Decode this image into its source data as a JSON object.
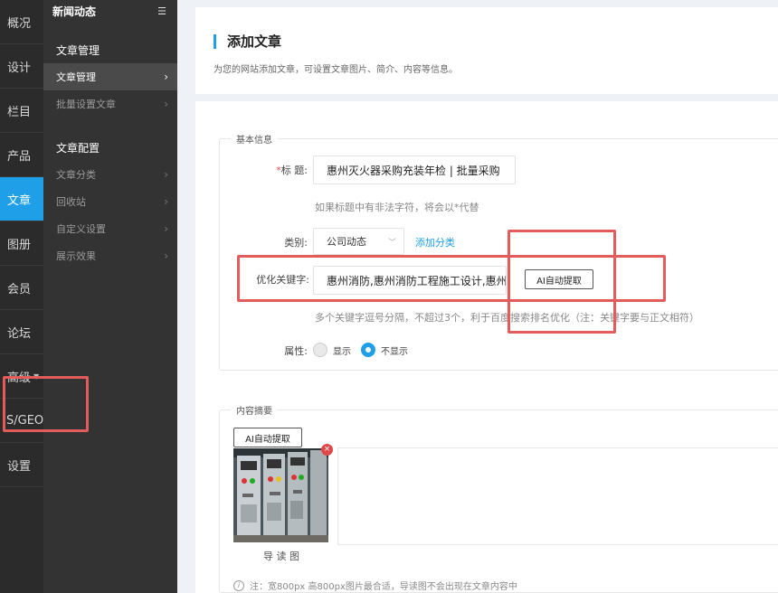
{
  "rail": {
    "items": [
      {
        "label": "概况"
      },
      {
        "label": "设计"
      },
      {
        "label": "栏目"
      },
      {
        "label": "产品"
      },
      {
        "label": "文章"
      },
      {
        "label": "图册"
      },
      {
        "label": "会员"
      },
      {
        "label": "论坛"
      },
      {
        "label": "高级"
      },
      {
        "label": "S/GEO"
      },
      {
        "label": "设置"
      }
    ]
  },
  "submenu": {
    "header": "新闻动态",
    "group1": "文章管理",
    "items1": [
      "文章管理",
      "批量设置文章"
    ],
    "group2": "文章配置",
    "items2": [
      "文章分类",
      "回收站",
      "自定义设置",
      "展示效果"
    ]
  },
  "page": {
    "title": "添加文章",
    "description": "为您的网站添加文章，可设置文章图片、简介、内容等信息。"
  },
  "basic": {
    "legend": "基本信息",
    "title_required_mark": "*",
    "title_label": "标 题:",
    "title_value": "惠州灭火器采购充装年检 | 批量采购",
    "title_hint": "如果标题中有非法字符，将会以*代替",
    "category_label": "类别:",
    "category_value": "公司动态",
    "add_category": "添加分类",
    "keywords_label": "优化关键字:",
    "keywords_value": "惠州消防,惠州消防工程施工设计,惠州",
    "ai_extract": "AI自动提取",
    "keywords_hint": "多个关键字逗号分隔，不超过3个，利于百度搜索排名优化（注：关键字要与正文相符）",
    "attr_label": "属性:",
    "show_label": "显示",
    "hide_label": "不显示",
    "attr_selected": "hide"
  },
  "summary": {
    "legend": "内容摘要",
    "ai_extract": "AI自动提取",
    "thumb_caption": "导 读 图",
    "note": "注：宽800px 高800px图片最合适，导读图不会出现在文章内容中"
  },
  "icons": {
    "collapse": "collapse-menu-icon",
    "chevron": "chevron-right-icon",
    "dropdown": "chevron-down-icon",
    "info": "info-icon",
    "delete": "close-icon"
  },
  "colors": {
    "accent": "#1e9fe8",
    "highlight": "#e35b5b",
    "rail_bg": "#2b2b2b",
    "submenu_bg": "#333333"
  }
}
